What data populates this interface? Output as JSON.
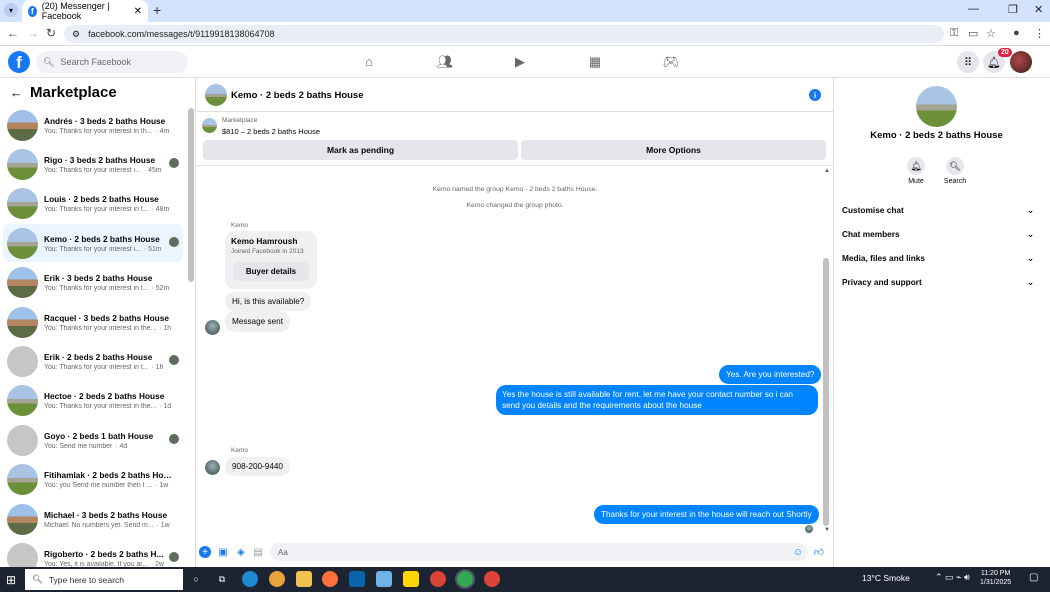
{
  "browser": {
    "tab_title": "(20) Messenger | Facebook",
    "url": "facebook.com/messages/t/9119918138064708",
    "new_tab": "+",
    "tab_close": "✕"
  },
  "fb": {
    "search_placeholder": "Search Facebook",
    "notif_count": "20"
  },
  "left": {
    "title": "Marketplace",
    "conversations": [
      {
        "name": "Andrés · 3 beds 2 baths House",
        "sub": "You: Thanks for your interest in th...",
        "time": "· 4m",
        "active": false
      },
      {
        "name": "Rigo · 3 beds 2 baths House",
        "sub": "You: Thanks for your interest i...",
        "time": "· 45m",
        "active": false
      },
      {
        "name": "Louis · 2 beds 2 baths House",
        "sub": "You: Thanks for your interest in t...",
        "time": "· 48m",
        "active": false
      },
      {
        "name": "Kemo · 2 beds 2 baths House",
        "sub": "You: Thanks for your interest i...",
        "time": "· 51m",
        "active": true
      },
      {
        "name": "Erik · 3 beds 2 baths House",
        "sub": "You: Thanks for your interest in t...",
        "time": "· 52m",
        "active": false
      },
      {
        "name": "Racquel · 3 beds 2 baths House",
        "sub": "You: Thanks for your interest in the...",
        "time": "· 1h",
        "active": false
      },
      {
        "name": "Erik · 2 beds 2 baths House",
        "sub": "You: Thanks for your interest in t...",
        "time": "· 1h",
        "active": false
      },
      {
        "name": "Hectoe · 2 beds 2 baths House",
        "sub": "You: Thanks for your interest in the...",
        "time": "· 1d",
        "active": false
      },
      {
        "name": "Goyo · 2 beds 1 bath House",
        "sub": "You: Send me number",
        "time": "· 4d",
        "active": false
      },
      {
        "name": "Fitihamlak · 2 beds 2 baths House",
        "sub": "You: you Send me number then I ...",
        "time": "· 1w",
        "active": false
      },
      {
        "name": "Michael · 3 beds 2 baths House",
        "sub": "Michael: No numbers yet. Send m...",
        "time": "· 1w",
        "active": false
      },
      {
        "name": "Rigoberto · 2 beds 2 baths H...",
        "sub": "You: Yes, it is available. If you ar...",
        "time": "· 2w",
        "active": false
      }
    ]
  },
  "chat": {
    "title": "Kemo · 2 beds 2 baths House",
    "marketplace_label": "Marketplace",
    "price_line": "$810 – 2 beds 2 baths House",
    "mark_pending": "Mark as pending",
    "more_options": "More Options",
    "system_msgs": [
      "Kemo named the group Kemo · 2 beds 2 baths House.",
      "Kemo changed the group photo."
    ],
    "sender_label": "Kemo",
    "card_name": "Kemo Hamroush",
    "card_joined": "Joined Facebook in 2013",
    "buyer_details": "Buyer details",
    "msg_available": "Hi, is this available?",
    "msg_sent": "Message sent",
    "out1": "Yes. Are you interested?",
    "out2": "Yes the house is still available for rent, let me have your contact number so i can send you details and the requirements about the house",
    "sender_label2": "Kemo",
    "in_phone": "908-200-9440",
    "out3": "Thanks for your interest in the house will reach out Shortly",
    "composer_placeholder": "Aa"
  },
  "right": {
    "title": "Kemo · 2 beds 2 baths House",
    "mute": "Mute",
    "search": "Search",
    "rows": [
      "Customise chat",
      "Chat members",
      "Media, files and links",
      "Privacy and support"
    ]
  },
  "taskbar": {
    "search_placeholder": "Type here to search",
    "weather": "13°C  Smoke",
    "time": "11:20 PM",
    "date": "1/31/2025"
  },
  "colors": {
    "brand": "#1877f2",
    "bubble_out": "#0084ff",
    "taskbar": "#1c2431"
  }
}
